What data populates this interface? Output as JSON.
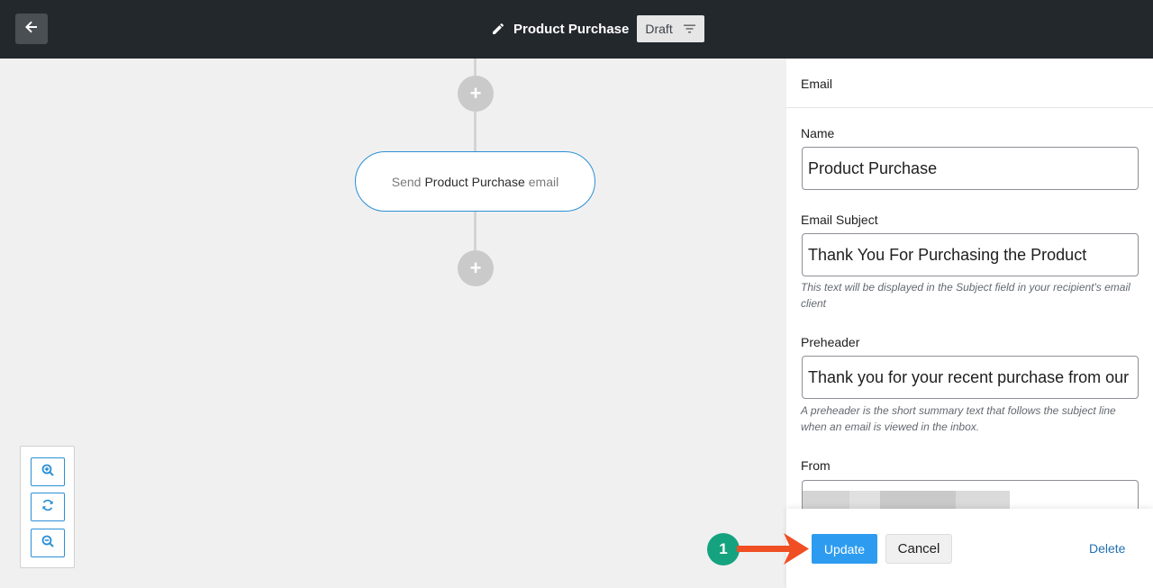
{
  "header": {
    "title": "Product Purchase",
    "status": "Draft",
    "back_icon": "arrow-left-icon",
    "edit_icon": "pencil-icon",
    "filter_icon": "filter-lines-icon"
  },
  "canvas": {
    "node": {
      "prefix": "Send",
      "name": "Product Purchase",
      "suffix": "email"
    },
    "add_symbol": "+",
    "zoom_controls": [
      "zoom-in-icon",
      "reset-view-icon",
      "zoom-out-icon"
    ]
  },
  "panel": {
    "heading": "Email",
    "name": {
      "label": "Name",
      "value": "Product Purchase"
    },
    "subject": {
      "label": "Email Subject",
      "value": "Thank You For Purchasing the Product",
      "help": "This text will be displayed in the Subject field in your recipient's email client"
    },
    "preheader": {
      "label": "Preheader",
      "value": "Thank you for your recent purchase from our store",
      "help": "A preheader is the short summary text that follows the subject line when an email is viewed in the inbox."
    },
    "from": {
      "label": "From"
    },
    "footer": {
      "update_label": "Update",
      "cancel_label": "Cancel",
      "delete_label": "Delete"
    }
  },
  "annotation": {
    "step_number": "1"
  },
  "colors": {
    "topbar": "#23282d",
    "accent": "#2d9cf0",
    "node_border": "#2a8fd6",
    "badge": "#15a37f",
    "arrow": "#f04e23"
  }
}
